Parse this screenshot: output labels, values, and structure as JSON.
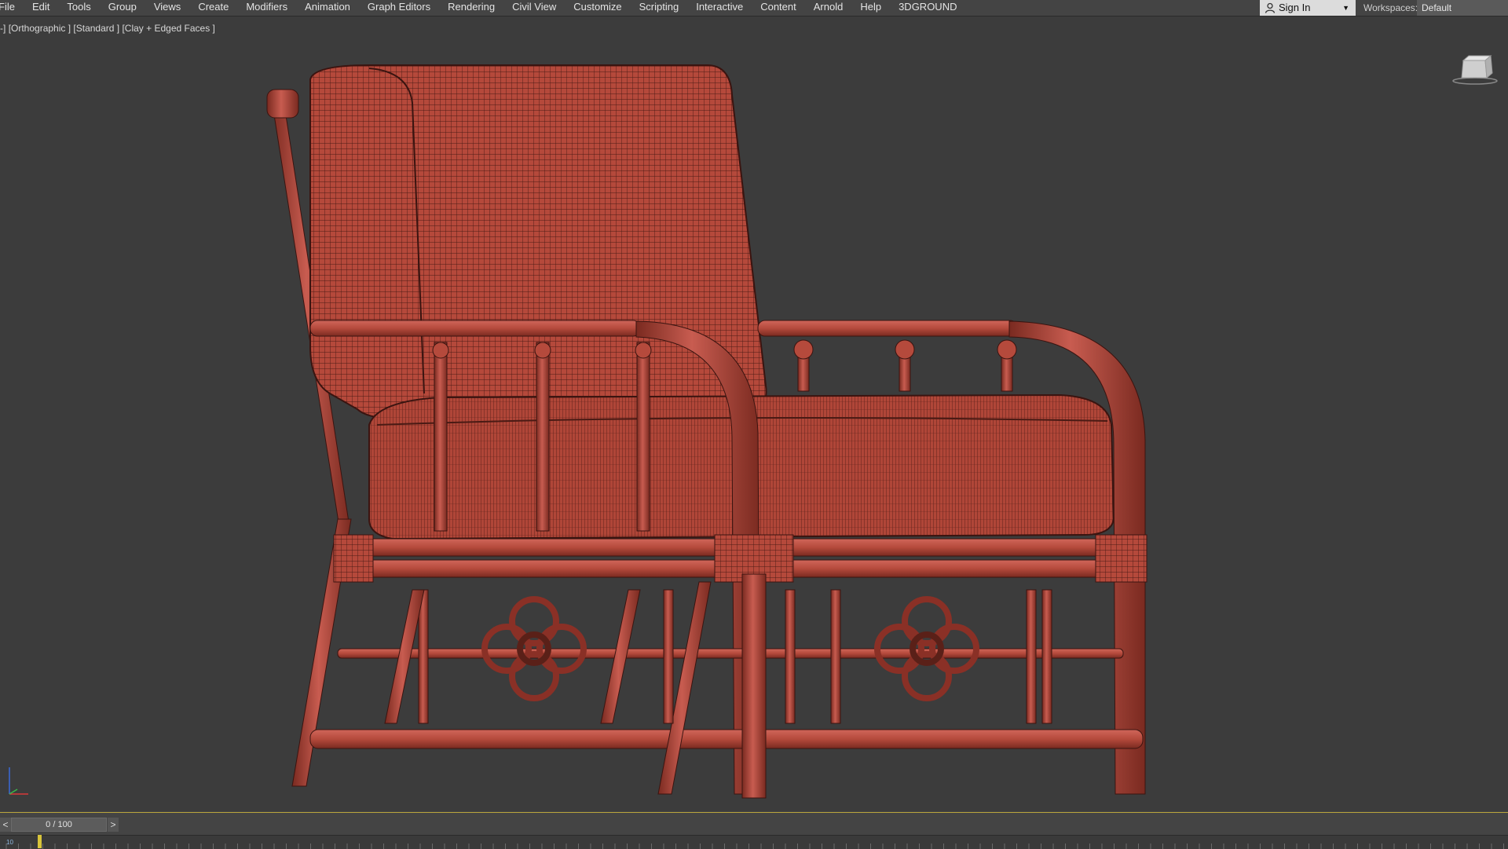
{
  "menu": {
    "items": [
      "File",
      "Edit",
      "Tools",
      "Group",
      "Views",
      "Create",
      "Modifiers",
      "Animation",
      "Graph Editors",
      "Rendering",
      "Civil View",
      "Customize",
      "Scripting",
      "Interactive",
      "Content",
      "Arnold",
      "Help",
      "3DGROUND"
    ]
  },
  "account": {
    "signin_label": "Sign In"
  },
  "workspaces": {
    "label": "Workspaces:",
    "value": "Default"
  },
  "viewport": {
    "label_prefix": "-]",
    "view": "[Orthographic ]",
    "shading": "[Standard ]",
    "mode": "[Clay + Edged Faces ]"
  },
  "timeline": {
    "slider_text": "0 / 100",
    "prev_label": "<",
    "next_label": ">",
    "track_start": "10"
  },
  "colors": {
    "viewport_bg": "#3c3c3c",
    "clay": "#b34a3c",
    "wire": "#3a1410",
    "accent_timeline": "#b8a43c"
  }
}
